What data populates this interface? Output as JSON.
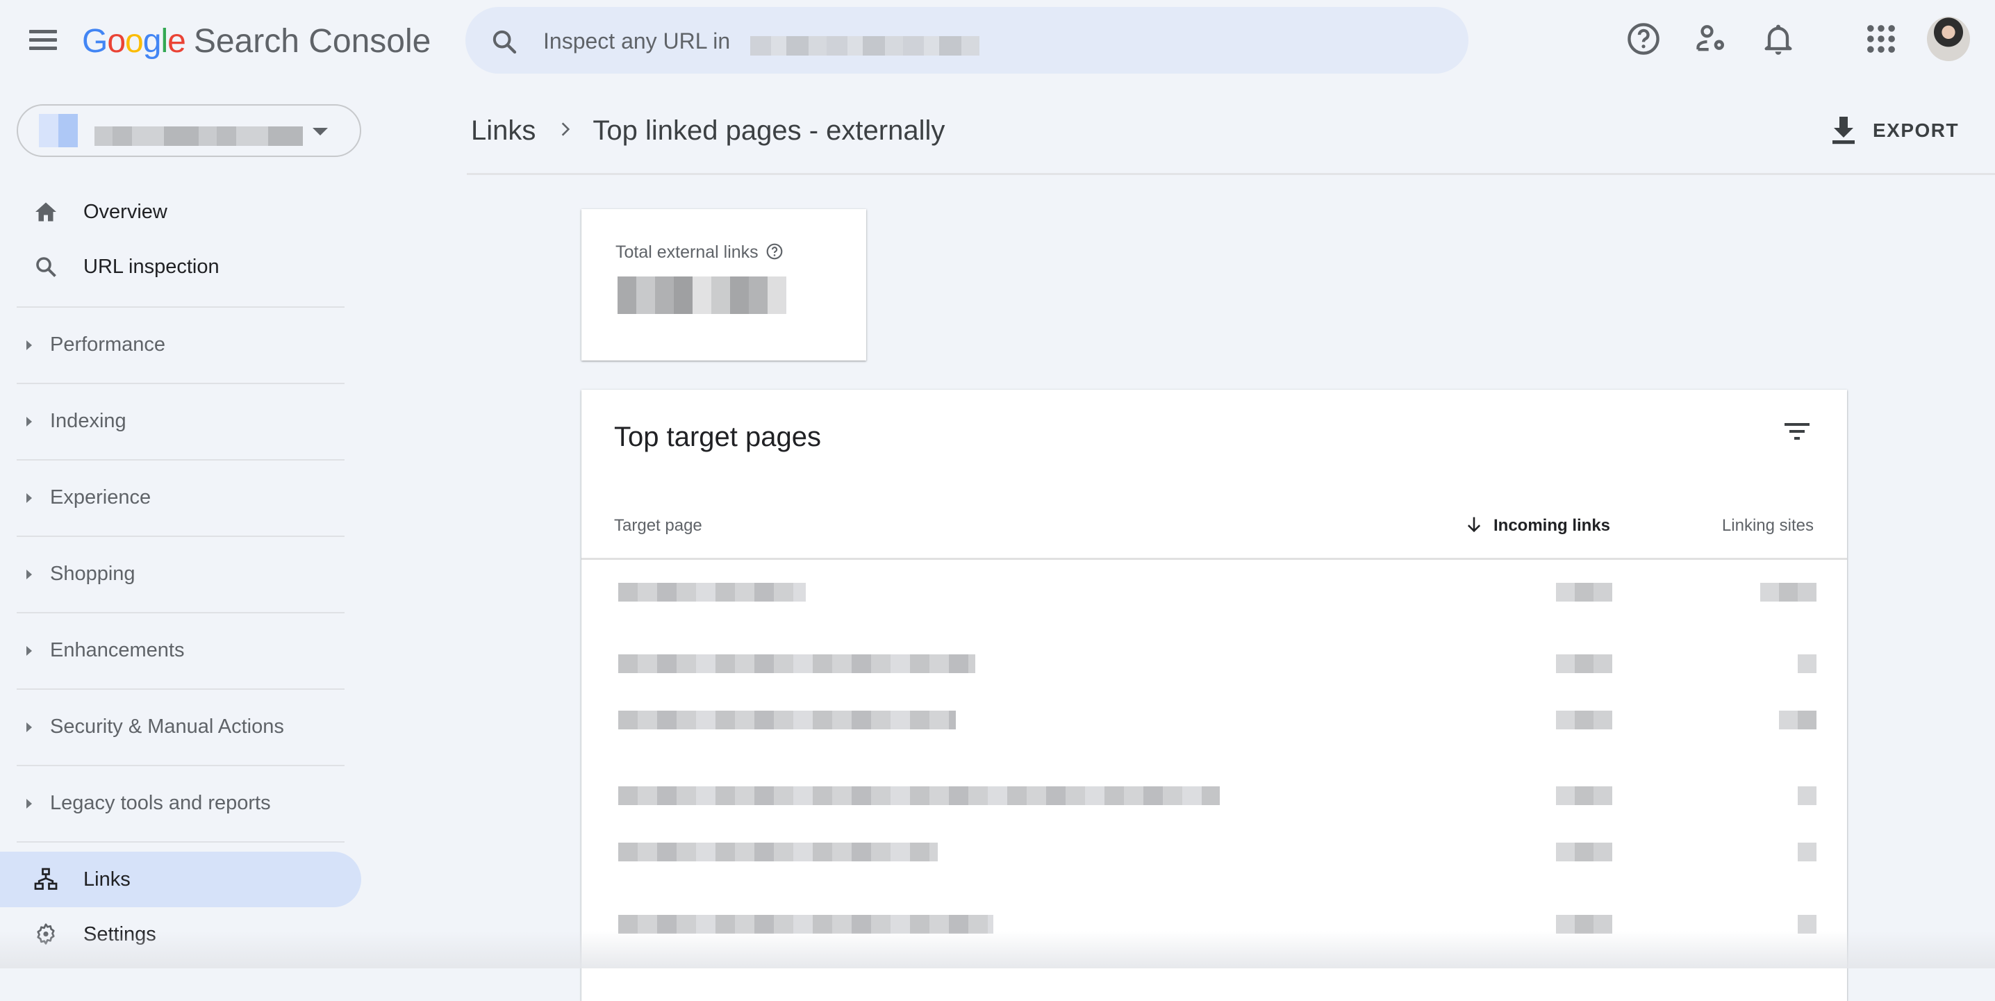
{
  "app": {
    "title_google": [
      "G",
      "o",
      "o",
      "g",
      "l",
      "e"
    ],
    "title_google_colors": [
      "#4285f4",
      "#ea4335",
      "#fbbc05",
      "#4285f4",
      "#34a853",
      "#ea4335"
    ],
    "product_name": "Search Console"
  },
  "topbar": {
    "menu_icon": "hamburger-menu-icon",
    "search_placeholder": "Inspect any URL in",
    "search_value_redacted": true,
    "icons": [
      "help-icon",
      "manage-users-icon",
      "notifications-bell-icon",
      "apps-grid-icon",
      "account-avatar"
    ]
  },
  "property_selector": {
    "value_redacted": true,
    "dropdown_icon": "caret-down-icon"
  },
  "sidebar": {
    "top_items": [
      {
        "label": "Overview",
        "icon": "home-icon"
      },
      {
        "label": "URL inspection",
        "icon": "search-icon"
      }
    ],
    "groups": [
      {
        "label": "Performance",
        "expanded": false
      },
      {
        "label": "Indexing",
        "expanded": false
      },
      {
        "label": "Experience",
        "expanded": false
      },
      {
        "label": "Shopping",
        "expanded": false
      },
      {
        "label": "Enhancements",
        "expanded": false
      },
      {
        "label": "Security & Manual Actions",
        "expanded": false
      },
      {
        "label": "Legacy tools and reports",
        "expanded": false
      }
    ],
    "bottom_items": [
      {
        "label": "Links",
        "icon": "sitemap-links-icon",
        "active": true
      },
      {
        "label": "Settings",
        "icon": "gear-icon",
        "active": false
      }
    ],
    "active_bg": "#d6e2f9"
  },
  "breadcrumb": {
    "parent": "Links",
    "current": "Top linked pages - externally"
  },
  "toolbar": {
    "export_label": "EXPORT",
    "export_icon": "download-icon"
  },
  "kpi": {
    "label": "Total external links",
    "help_icon": "help-circle-icon",
    "value_redacted": true
  },
  "table": {
    "title": "Top target pages",
    "filter_icon": "filter-list-icon",
    "columns": [
      {
        "label": "Target page",
        "sorted": false
      },
      {
        "label": "Incoming links",
        "sorted": true,
        "sort_direction": "descending"
      },
      {
        "label": "Linking sites",
        "sorted": false
      }
    ],
    "rows": [
      {
        "target_page": "[redacted]",
        "incoming_links": "[redacted]",
        "linking_sites": "[redacted]"
      },
      {
        "target_page": "[redacted]",
        "incoming_links": "[redacted]",
        "linking_sites": "[redacted]"
      },
      {
        "target_page": "[redacted]",
        "incoming_links": "[redacted]",
        "linking_sites": "[redacted]"
      },
      {
        "target_page": "[redacted]",
        "incoming_links": "[redacted]",
        "linking_sites": "[redacted]"
      },
      {
        "target_page": "[redacted]",
        "incoming_links": "[redacted]",
        "linking_sites": "[redacted]"
      },
      {
        "target_page": "[redacted]",
        "incoming_links": "[redacted]",
        "linking_sites": "[redacted]"
      }
    ]
  }
}
